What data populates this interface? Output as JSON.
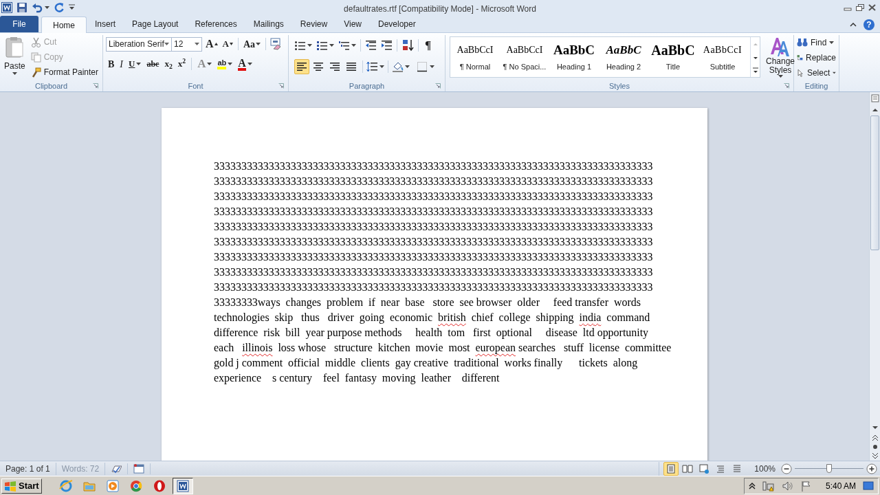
{
  "title_bar": {
    "title": "defaultrates.rtf [Compatibility Mode]  -  Microsoft Word"
  },
  "tabs": [
    {
      "label": "File",
      "kind": "file",
      "selected": false
    },
    {
      "label": "Home",
      "kind": "tab",
      "selected": true
    },
    {
      "label": "Insert",
      "kind": "tab",
      "selected": false
    },
    {
      "label": "Page Layout",
      "kind": "tab",
      "selected": false
    },
    {
      "label": "References",
      "kind": "tab",
      "selected": false
    },
    {
      "label": "Mailings",
      "kind": "tab",
      "selected": false
    },
    {
      "label": "Review",
      "kind": "tab",
      "selected": false
    },
    {
      "label": "View",
      "kind": "tab",
      "selected": false
    },
    {
      "label": "Developer",
      "kind": "tab",
      "selected": false
    }
  ],
  "help": "?",
  "ribbon": {
    "clipboard": {
      "label": "Clipboard",
      "paste": "Paste",
      "items": [
        {
          "label": "Cut",
          "kind": "cut",
          "disabled": true
        },
        {
          "label": "Copy",
          "kind": "copy",
          "disabled": true
        },
        {
          "label": "Format Painter",
          "kind": "painter",
          "disabled": false
        }
      ]
    },
    "font": {
      "label": "Font",
      "font_name": "Liberation Serif",
      "font_size": "12",
      "top_buttons": [
        {
          "label": "A",
          "kind": "grow"
        },
        {
          "label": "A",
          "kind": "shrink"
        },
        {
          "label": "Aa",
          "kind": "case"
        }
      ],
      "format_buttons": [
        {
          "label": "B",
          "kind": "bold"
        },
        {
          "label": "I",
          "kind": "italic"
        },
        {
          "label": "U",
          "kind": "underline"
        },
        {
          "label": "abc",
          "kind": "strike"
        },
        {
          "label": "x$_{2}$",
          "kind": "script"
        },
        {
          "label": "x$^{2}$",
          "kind": "script"
        },
        {
          "label": "A",
          "kind": "effects"
        },
        {
          "label": "ab",
          "kind": "highlight"
        },
        {
          "label": "A",
          "kind": "color"
        }
      ]
    },
    "paragraph": {
      "label": "Paragraph",
      "pilcrow": "¶",
      "align": [
        {
          "kind": "left",
          "selected": true
        },
        {
          "kind": "center",
          "selected": false
        },
        {
          "kind": "right",
          "selected": false
        },
        {
          "kind": "justify",
          "selected": false
        }
      ]
    },
    "styles": {
      "label": "Styles",
      "items": [
        {
          "sample": "AaBbCcI",
          "name": "¶ Normal",
          "kind": "plain"
        },
        {
          "sample": "AaBbCcI",
          "name": "¶ No Spaci...",
          "kind": "plain"
        },
        {
          "sample": "AaBbC",
          "name": "Heading 1",
          "kind": "heading"
        },
        {
          "sample": "AaBbC",
          "name": "Heading 2",
          "kind": "heading_italic"
        },
        {
          "sample": "AaBbC",
          "name": "Title",
          "kind": "title"
        },
        {
          "sample": "AaBbCcI",
          "name": "Subtitle",
          "kind": "subtitle"
        }
      ],
      "change_styles": "Change Styles"
    },
    "editing": {
      "label": "Editing",
      "items": [
        {
          "label": "Find",
          "kind": "find"
        },
        {
          "label": "Replace",
          "kind": "replace"
        },
        {
          "label": "Select",
          "kind": "select"
        }
      ]
    }
  },
  "document": {
    "lines": [
      [
        {
          "text": "33333333333333333333333333333333333333333333333333333333333333333333333333333333",
          "misspelled": false
        }
      ],
      [
        {
          "text": "33333333333333333333333333333333333333333333333333333333333333333333333333333333",
          "misspelled": false
        }
      ],
      [
        {
          "text": "33333333333333333333333333333333333333333333333333333333333333333333333333333333",
          "misspelled": false
        }
      ],
      [
        {
          "text": "33333333333333333333333333333333333333333333333333333333333333333333333333333333",
          "misspelled": false
        }
      ],
      [
        {
          "text": "33333333333333333333333333333333333333333333333333333333333333333333333333333333",
          "misspelled": false
        }
      ],
      [
        {
          "text": "33333333333333333333333333333333333333333333333333333333333333333333333333333333",
          "misspelled": false
        }
      ],
      [
        {
          "text": "33333333333333333333333333333333333333333333333333333333333333333333333333333333",
          "misspelled": false
        }
      ],
      [
        {
          "text": "33333333333333333333333333333333333333333333333333333333333333333333333333333333",
          "misspelled": false
        }
      ],
      [
        {
          "text": "33333333333333333333333333333333333333333333333333333333333333333333333333333333",
          "misspelled": false
        }
      ],
      [
        {
          "text": "33333333ways  changes  problem  if  near  base   store  see browser  older     feed transfer  words",
          "misspelled": false
        }
      ],
      [
        {
          "text": "technologies  skip   thus   driver  going  economic  ",
          "misspelled": false
        },
        {
          "text": "british",
          "misspelled": true
        },
        {
          "text": "  chief  college  shipping  ",
          "misspelled": false
        },
        {
          "text": "india",
          "misspelled": true
        },
        {
          "text": "  command",
          "misspelled": false
        }
      ],
      [
        {
          "text": "difference  risk  bill  year purpose methods     health  tom   first  optional     disease  ltd opportunity",
          "misspelled": false
        }
      ],
      [
        {
          "text": "each   ",
          "misspelled": false
        },
        {
          "text": "illinois",
          "misspelled": true
        },
        {
          "text": "  loss whose   structure  kitchen  movie  most  ",
          "misspelled": false
        },
        {
          "text": "european",
          "misspelled": true
        },
        {
          "text": " searches   stuff  license  committee",
          "misspelled": false
        }
      ],
      [
        {
          "text": "gold j comment  official  middle  clients  gay creative  traditional  works finally      tickets  along",
          "misspelled": false
        }
      ],
      [
        {
          "text": "experience    s century    feel  fantasy  moving  leather    different",
          "misspelled": false
        }
      ]
    ]
  },
  "status_bar": {
    "page": "Page: 1 of 1",
    "words": "Words: 72",
    "views": [
      {
        "kind": "print",
        "selected": true
      },
      {
        "kind": "reading",
        "selected": false
      },
      {
        "kind": "web",
        "selected": false
      },
      {
        "kind": "outline",
        "selected": false
      },
      {
        "kind": "draft",
        "selected": false
      }
    ],
    "zoom": "100%",
    "zoom_slider": {
      "level": 0.5
    }
  },
  "taskbar": {
    "start": "Start",
    "apps": [
      {
        "kind": "ie",
        "active": false
      },
      {
        "kind": "folder",
        "active": false
      },
      {
        "kind": "media",
        "active": false
      },
      {
        "kind": "chrome",
        "active": false
      },
      {
        "kind": "opera",
        "active": false
      },
      {
        "kind": "word",
        "active": true
      }
    ],
    "clock": "5:40 AM"
  }
}
